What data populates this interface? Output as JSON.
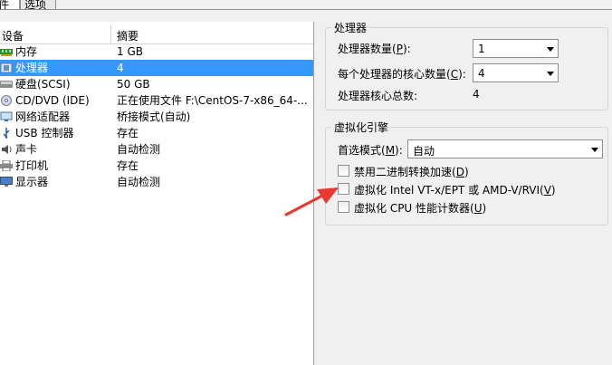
{
  "tabs": [
    {
      "label": "件"
    },
    {
      "label": "选项"
    }
  ],
  "device_list": {
    "columns": {
      "device": "设备",
      "summary": "摘要"
    },
    "rows": [
      {
        "name": "内存",
        "summary": "1 GB",
        "icon": "memory-icon"
      },
      {
        "name": "处理器",
        "summary": "4",
        "icon": "processor-icon",
        "selected": true
      },
      {
        "name": "硬盘(SCSI)",
        "summary": "50 GB",
        "icon": "hard-disk-icon"
      },
      {
        "name": "CD/DVD (IDE)",
        "summary": "正在使用文件 F:\\CentOS-7-x86_64-...",
        "icon": "cd-dvd-icon"
      },
      {
        "name": "网络适配器",
        "summary": "桥接模式(自动)",
        "icon": "network-adapter-icon"
      },
      {
        "name": "USB 控制器",
        "summary": "存在",
        "icon": "usb-icon"
      },
      {
        "name": "声卡",
        "summary": "自动检测",
        "icon": "sound-card-icon"
      },
      {
        "name": "打印机",
        "summary": "存在",
        "icon": "printer-icon"
      },
      {
        "name": "显示器",
        "summary": "自动检测",
        "icon": "display-icon"
      }
    ]
  },
  "processor": {
    "title": "处理器",
    "count_label": "处理器数量(",
    "count_key": "P",
    "count_suffix": "):",
    "count_value": "1",
    "cores_label": "每个处理器的核心数量(",
    "cores_key": "C",
    "cores_suffix": "):",
    "cores_value": "4",
    "total_label": "处理器核心总数:",
    "total_value": "4"
  },
  "virtualization": {
    "title": "虚拟化引擎",
    "mode_label": "首选模式(",
    "mode_key": "M",
    "mode_suffix": "):",
    "mode_value": "自动",
    "options": [
      {
        "label": "禁用二进制转换加速(",
        "key": "D",
        "suffix": ")"
      },
      {
        "label": "虚拟化 Intel VT-x/EPT 或 AMD-V/RVI(",
        "key": "V",
        "suffix": ")"
      },
      {
        "label": "虚拟化 CPU 性能计数器(",
        "key": "U",
        "suffix": ")"
      }
    ]
  },
  "colors": {
    "selection": "#3399ff",
    "arrow": "#e8382f"
  }
}
